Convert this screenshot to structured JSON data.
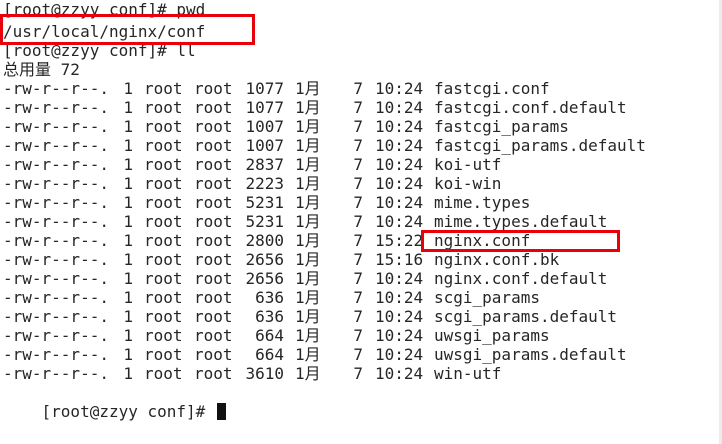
{
  "terminal": {
    "prompt1": "[root@zzyy conf]# pwd",
    "pwd_output": "/usr/local/nginx/conf",
    "prompt2": "[root@zzyy conf]# ll",
    "total": "总用量 72",
    "files": [
      {
        "perm": "-rw-r--r--.",
        "links": "1",
        "owner": "root",
        "group": "root",
        "size": "1077",
        "month": "1月",
        "day": "7",
        "time": "10:24",
        "name": "fastcgi.conf"
      },
      {
        "perm": "-rw-r--r--.",
        "links": "1",
        "owner": "root",
        "group": "root",
        "size": "1077",
        "month": "1月",
        "day": "7",
        "time": "10:24",
        "name": "fastcgi.conf.default"
      },
      {
        "perm": "-rw-r--r--.",
        "links": "1",
        "owner": "root",
        "group": "root",
        "size": "1007",
        "month": "1月",
        "day": "7",
        "time": "10:24",
        "name": "fastcgi_params"
      },
      {
        "perm": "-rw-r--r--.",
        "links": "1",
        "owner": "root",
        "group": "root",
        "size": "1007",
        "month": "1月",
        "day": "7",
        "time": "10:24",
        "name": "fastcgi_params.default"
      },
      {
        "perm": "-rw-r--r--.",
        "links": "1",
        "owner": "root",
        "group": "root",
        "size": "2837",
        "month": "1月",
        "day": "7",
        "time": "10:24",
        "name": "koi-utf"
      },
      {
        "perm": "-rw-r--r--.",
        "links": "1",
        "owner": "root",
        "group": "root",
        "size": "2223",
        "month": "1月",
        "day": "7",
        "time": "10:24",
        "name": "koi-win"
      },
      {
        "perm": "-rw-r--r--.",
        "links": "1",
        "owner": "root",
        "group": "root",
        "size": "5231",
        "month": "1月",
        "day": "7",
        "time": "10:24",
        "name": "mime.types"
      },
      {
        "perm": "-rw-r--r--.",
        "links": "1",
        "owner": "root",
        "group": "root",
        "size": "5231",
        "month": "1月",
        "day": "7",
        "time": "10:24",
        "name": "mime.types.default"
      },
      {
        "perm": "-rw-r--r--.",
        "links": "1",
        "owner": "root",
        "group": "root",
        "size": "2800",
        "month": "1月",
        "day": "7",
        "time": "15:22",
        "name": "nginx.conf"
      },
      {
        "perm": "-rw-r--r--.",
        "links": "1",
        "owner": "root",
        "group": "root",
        "size": "2656",
        "month": "1月",
        "day": "7",
        "time": "15:16",
        "name": "nginx.conf.bk"
      },
      {
        "perm": "-rw-r--r--.",
        "links": "1",
        "owner": "root",
        "group": "root",
        "size": "2656",
        "month": "1月",
        "day": "7",
        "time": "10:24",
        "name": "nginx.conf.default"
      },
      {
        "perm": "-rw-r--r--.",
        "links": "1",
        "owner": "root",
        "group": "root",
        "size": "636",
        "month": "1月",
        "day": "7",
        "time": "10:24",
        "name": "scgi_params"
      },
      {
        "perm": "-rw-r--r--.",
        "links": "1",
        "owner": "root",
        "group": "root",
        "size": "636",
        "month": "1月",
        "day": "7",
        "time": "10:24",
        "name": "scgi_params.default"
      },
      {
        "perm": "-rw-r--r--.",
        "links": "1",
        "owner": "root",
        "group": "root",
        "size": "664",
        "month": "1月",
        "day": "7",
        "time": "10:24",
        "name": "uwsgi_params"
      },
      {
        "perm": "-rw-r--r--.",
        "links": "1",
        "owner": "root",
        "group": "root",
        "size": "664",
        "month": "1月",
        "day": "7",
        "time": "10:24",
        "name": "uwsgi_params.default"
      },
      {
        "perm": "-rw-r--r--.",
        "links": "1",
        "owner": "root",
        "group": "root",
        "size": "3610",
        "month": "1月",
        "day": "7",
        "time": "10:24",
        "name": "win-utf"
      }
    ],
    "final_prompt": "[root@zzyy conf]# "
  },
  "colors": {
    "highlight": "#e8000b",
    "text": "#262626",
    "background": "#ffffff"
  }
}
